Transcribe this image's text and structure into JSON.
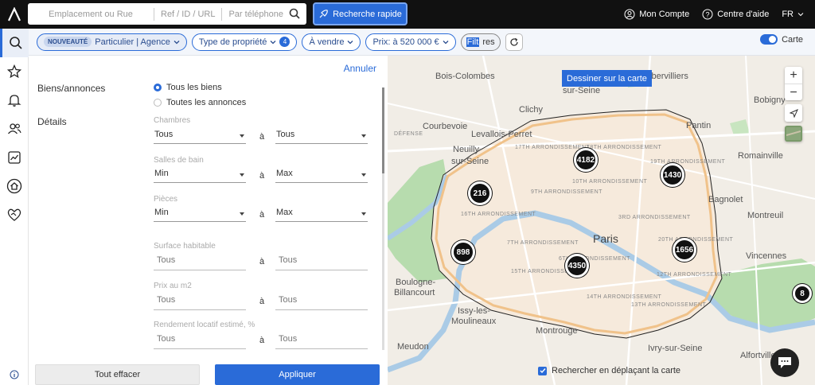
{
  "header": {
    "search_placeholders": [
      "Emplacement ou Rue",
      "Ref / ID / URL",
      "Par téléphone"
    ],
    "quick_search_label": "Recherche rapide",
    "account_label": "Mon Compte",
    "help_label": "Centre d'aide",
    "language": "FR"
  },
  "sidebar": {
    "items": [
      "search-icon",
      "star-icon",
      "bell-icon",
      "users-icon",
      "chart-icon",
      "home-search-icon",
      "handshake-icon"
    ],
    "info_icon": "info-icon"
  },
  "filterbar": {
    "new_badge": "NOUVEAUTÉ",
    "seller_type": "Particulier | Agence",
    "property_type": "Type de propriété",
    "property_type_count": "4",
    "transaction": "À vendre",
    "price": "Prix: à 520 000 €",
    "filters_highlight": "Filt",
    "filters_rest": "res",
    "map_toggle_label": "Carte"
  },
  "panel": {
    "cancel": "Annuler",
    "listings_label": "Biens/annonces",
    "radio_all_goods": "Tous les biens",
    "radio_all_listings": "Toutes les annonces",
    "details_label": "Détails",
    "to": "à",
    "bedrooms": {
      "label": "Chambres",
      "from": "Tous",
      "to": "Tous"
    },
    "bathrooms": {
      "label": "Salles de bain",
      "from": "Min",
      "to": "Max"
    },
    "rooms": {
      "label": "Pièces",
      "from": "Min",
      "to": "Max"
    },
    "living_area": {
      "label": "Surface habitable",
      "from": "Tous",
      "to": "Tous"
    },
    "price_m2": {
      "label": "Prix au m2",
      "from": "Tous",
      "to": "Tous"
    },
    "yield": {
      "label": "Rendement locatif estimé, %",
      "from": "Tous",
      "to": "Tous"
    },
    "clear_all": "Tout effacer",
    "apply": "Appliquer"
  },
  "map": {
    "draw_button": "Dessiner sur la carte",
    "search_on_move": "Rechercher en déplaçant la carte",
    "zoom_in": "+",
    "zoom_out": "−",
    "labels": {
      "bois_colombes": "Bois-Colombes",
      "aubervilliers": "Aubervilliers",
      "sur_seine": "sur-Seine",
      "bobigny": "Bobigny",
      "clichy": "Clichy",
      "courbevoie": "Courbevoie",
      "levallois": "Levallois-Perret",
      "pantin": "Pantin",
      "neuilly": "Neuilly-",
      "neuilly2": "sur-Seine",
      "romainville": "Romainville",
      "bagnolet": "Bagnolet",
      "montreuil": "Montreuil",
      "paris": "Paris",
      "vincennes": "Vincennes",
      "boulogne": "Boulogne-",
      "billancourt": "Billancourt",
      "issy": "Issy-les-",
      "moulineaux": "Moulineaux",
      "montrouge": "Montrouge",
      "meudon": "Meudon",
      "ivry": "Ivry-sur-Seine",
      "alfortville": "Alfortville",
      "defense": "DÉFENSE",
      "arr17": "17TH ARRONDISSEMENT",
      "arr18": "18TH ARRONDISSEMENT",
      "arr19": "19TH ARRONDISSEMENT",
      "arr16": "16TH ARRONDISSEMENT",
      "arr20": "20TH ARRONDISSEMENT",
      "arr15": "15TH ARRONDISSEMENT",
      "arr14": "14TH ARRONDISSEMENT",
      "arr12": "12TH ARRONDISSEMENT",
      "arr13": "13TH ARRONDISSEMENT",
      "arr7": "7TH ARRONDISSEMENT",
      "arr6": "6TH ARRONDISSEMENT",
      "arr10": "10TH ARRONDISSEMENT",
      "arr9": "9TH ARRONDISSEMENT",
      "arr3": "3RD ARRONDISSEMENT"
    },
    "clusters": [
      "4182",
      "1430",
      "216",
      "898",
      "4350",
      "1656",
      "8"
    ]
  }
}
